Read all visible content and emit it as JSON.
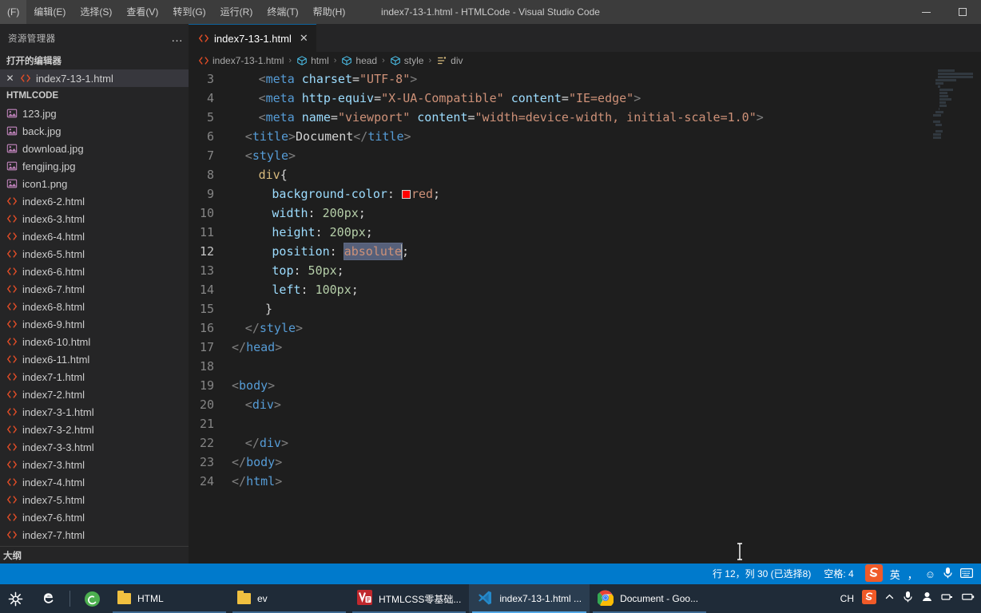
{
  "window": {
    "title": "index7-13-1.html - HTMLCode - Visual Studio Code",
    "minimize_label": "最小化",
    "maximize_label": "还原"
  },
  "menubar": {
    "items": [
      {
        "label": "(F)"
      },
      {
        "label": "编辑(E)"
      },
      {
        "label": "选择(S)"
      },
      {
        "label": "查看(V)"
      },
      {
        "label": "转到(G)"
      },
      {
        "label": "运行(R)"
      },
      {
        "label": "终端(T)"
      },
      {
        "label": "帮助(H)"
      }
    ]
  },
  "sidebar": {
    "title": "资源管理器",
    "more_label": "…",
    "open_editors_header": "打开的编辑器",
    "open_editors": [
      {
        "close": "✕",
        "label": "index7-13-1.html"
      }
    ],
    "folder_header": "HTMLCODE",
    "files": [
      {
        "label": "123.jpg",
        "type": "image"
      },
      {
        "label": "back.jpg",
        "type": "image"
      },
      {
        "label": "download.jpg",
        "type": "image"
      },
      {
        "label": "fengjing.jpg",
        "type": "image"
      },
      {
        "label": "icon1.png",
        "type": "image"
      },
      {
        "label": "index6-2.html",
        "type": "html"
      },
      {
        "label": "index6-3.html",
        "type": "html"
      },
      {
        "label": "index6-4.html",
        "type": "html"
      },
      {
        "label": "index6-5.html",
        "type": "html"
      },
      {
        "label": "index6-6.html",
        "type": "html"
      },
      {
        "label": "index6-7.html",
        "type": "html"
      },
      {
        "label": "index6-8.html",
        "type": "html"
      },
      {
        "label": "index6-9.html",
        "type": "html"
      },
      {
        "label": "index6-10.html",
        "type": "html"
      },
      {
        "label": "index6-11.html",
        "type": "html"
      },
      {
        "label": "index7-1.html",
        "type": "html"
      },
      {
        "label": "index7-2.html",
        "type": "html"
      },
      {
        "label": "index7-3-1.html",
        "type": "html"
      },
      {
        "label": "index7-3-2.html",
        "type": "html"
      },
      {
        "label": "index7-3-3.html",
        "type": "html"
      },
      {
        "label": "index7-3.html",
        "type": "html"
      },
      {
        "label": "index7-4.html",
        "type": "html"
      },
      {
        "label": "index7-5.html",
        "type": "html"
      },
      {
        "label": "index7-6.html",
        "type": "html"
      },
      {
        "label": "index7-7.html",
        "type": "html"
      }
    ],
    "outline_header": "大纲"
  },
  "editor": {
    "tab": {
      "label": "index7-13-1.html",
      "close": "✕"
    },
    "breadcrumb": [
      {
        "label": "index7-13-1.html",
        "icon": "html-file-icon"
      },
      {
        "label": "html",
        "icon": "cube-icon"
      },
      {
        "label": "head",
        "icon": "cube-icon"
      },
      {
        "label": "style",
        "icon": "cube-icon"
      },
      {
        "label": "div",
        "icon": "css-rule-icon"
      }
    ],
    "breadcrumb_separator": "›",
    "first_visible_line": 3,
    "active_line": 12,
    "selected_word": "absolute",
    "color_swatch": "#ff0000",
    "lines": [
      {
        "n": 3,
        "html": "<span class=\"t-brk\">&lt;</span><span class=\"t-tag\">meta</span> <span class=\"t-attr\">charset</span><span class=\"t-punc\">=</span><span class=\"t-str\">\"UTF-8\"</span><span class=\"t-brk\">&gt;</span>"
      },
      {
        "n": 4,
        "html": "<span class=\"t-brk\">&lt;</span><span class=\"t-tag\">meta</span> <span class=\"t-attr\">http-equiv</span><span class=\"t-punc\">=</span><span class=\"t-str\">\"X-UA-Compatible\"</span> <span class=\"t-attr\">content</span><span class=\"t-punc\">=</span><span class=\"t-str\">\"IE=edge\"</span><span class=\"t-brk\">&gt;</span>"
      },
      {
        "n": 5,
        "html": "<span class=\"t-brk\">&lt;</span><span class=\"t-tag\">meta</span> <span class=\"t-attr\">name</span><span class=\"t-punc\">=</span><span class=\"t-str\">\"viewport\"</span> <span class=\"t-attr\">content</span><span class=\"t-punc\">=</span><span class=\"t-str\">\"width=device-width, initial-scale=1.0\"</span><span class=\"t-brk\">&gt;</span>"
      },
      {
        "n": 6,
        "html": "<span class=\"t-brk\">&lt;</span><span class=\"t-tag\">title</span><span class=\"t-brk\">&gt;</span><span class=\"t-txt\">Document</span><span class=\"t-brk\">&lt;/</span><span class=\"t-tag\">title</span><span class=\"t-brk\">&gt;</span>"
      },
      {
        "n": 7,
        "html": "<span class=\"t-brk\">&lt;</span><span class=\"t-tag\">style</span><span class=\"t-brk\">&gt;</span>"
      },
      {
        "n": 8,
        "html": "<span class=\"t-sel\">div</span><span class=\"t-punc\">{</span>"
      },
      {
        "n": 9,
        "html": "<span class=\"t-prop\">background-color</span><span class=\"t-punc\">: </span><span class=\"swatch-slot\"></span><span class=\"t-red\">red</span><span class=\"t-punc\">;</span>"
      },
      {
        "n": 10,
        "html": "<span class=\"t-prop\">width</span><span class=\"t-punc\">: </span><span class=\"t-val\">200px</span><span class=\"t-punc\">;</span>"
      },
      {
        "n": 11,
        "html": "<span class=\"t-prop\">height</span><span class=\"t-punc\">: </span><span class=\"t-val\">200px</span><span class=\"t-punc\">;</span>"
      },
      {
        "n": 12,
        "html": "<span class=\"t-prop\">position</span><span class=\"t-punc\">: </span><span class=\"selword\">absolute</span><span class=\"caret\"></span><span class=\"t-punc\">;</span>"
      },
      {
        "n": 13,
        "html": "<span class=\"t-prop\">top</span><span class=\"t-punc\">: </span><span class=\"t-val\">50px</span><span class=\"t-punc\">;</span>"
      },
      {
        "n": 14,
        "html": "<span class=\"t-prop\">left</span><span class=\"t-punc\">: </span><span class=\"t-val\">100px</span><span class=\"t-punc\">;</span>"
      },
      {
        "n": 15,
        "html": "<span class=\"t-punc\">}</span>"
      },
      {
        "n": 16,
        "html": "<span class=\"t-brk\">&lt;/</span><span class=\"t-tag\">style</span><span class=\"t-brk\">&gt;</span>"
      },
      {
        "n": 17,
        "html": "<span class=\"t-brk\">&lt;/</span><span class=\"t-tag\">head</span><span class=\"t-brk\">&gt;</span>"
      },
      {
        "n": 18,
        "html": ""
      },
      {
        "n": 19,
        "html": "<span class=\"t-brk\">&lt;</span><span class=\"t-tag\">body</span><span class=\"t-brk\">&gt;</span>"
      },
      {
        "n": 20,
        "html": "<span class=\"t-brk\">&lt;</span><span class=\"t-tag\">div</span><span class=\"t-brk\">&gt;</span>"
      },
      {
        "n": 21,
        "html": ""
      },
      {
        "n": 22,
        "html": "<span class=\"t-brk\">&lt;/</span><span class=\"t-tag\">div</span><span class=\"t-brk\">&gt;</span>"
      },
      {
        "n": 23,
        "html": "<span class=\"t-brk\">&lt;/</span><span class=\"t-tag\">body</span><span class=\"t-brk\">&gt;</span>"
      },
      {
        "n": 24,
        "html": "<span class=\"t-brk\">&lt;/</span><span class=\"t-tag\">html</span><span class=\"t-brk\">&gt;</span>"
      }
    ],
    "indents": [
      4,
      4,
      4,
      2,
      2,
      4,
      6,
      6,
      6,
      6,
      6,
      6,
      5,
      2,
      0,
      0,
      0,
      2,
      0,
      2,
      0,
      0
    ],
    "code_plain": {
      "l3": "<meta charset=\"UTF-8\">",
      "l4": "<meta http-equiv=\"X-UA-Compatible\" content=\"IE=edge\">",
      "l5": "<meta name=\"viewport\" content=\"width=device-width, initial-scale=1.0\">",
      "l6": "<title>Document</title>",
      "l7": "<style>",
      "l8": "div{",
      "l9": "background-color: red;",
      "l10": "width: 200px;",
      "l11": "height: 200px;",
      "l12": "position: absolute;",
      "l13": "top: 50px;",
      "l14": "left: 100px;",
      "l15": "}",
      "l16": "</style>",
      "l17": "</head>",
      "l19": "<body>",
      "l20": "<div>",
      "l22": "</div>",
      "l23": "</body>",
      "l24": "</html>"
    }
  },
  "statusbar": {
    "position": "行 12，列 30 (已选择8)",
    "indent": "空格: 4",
    "ime": {
      "logo": "S",
      "mode": "英",
      "punctuation": "，",
      "emoji": "☺",
      "voice": "🎤",
      "keyboard": "⌨"
    }
  },
  "taskbar": {
    "start_icon": "windows-start-icon",
    "items": [
      {
        "label": "",
        "icon": "edge-icon",
        "state": "pinned"
      },
      {
        "label": "",
        "icon": "browser-green-icon",
        "state": "pinned"
      },
      {
        "label": "HTML",
        "icon": "folder-icon",
        "state": "open"
      },
      {
        "label": "ev",
        "icon": "folder-icon",
        "state": "open"
      },
      {
        "label": "HTMLCSS零基础...",
        "icon": "video-icon",
        "state": "open"
      },
      {
        "label": "index7-13-1.html ...",
        "icon": "vscode-icon",
        "state": "active"
      },
      {
        "label": "Document - Goo...",
        "icon": "chrome-icon",
        "state": "open"
      }
    ],
    "tray": {
      "lang": "CH",
      "sogou": "S",
      "chevron": "︿",
      "mic": "🎤",
      "network": "📶",
      "battery": "🔋"
    }
  }
}
